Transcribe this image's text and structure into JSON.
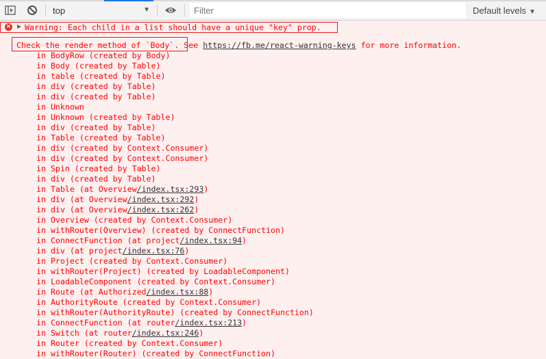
{
  "toolbar": {
    "sidebar_toggle_icon": "sidebar-toggle-icon",
    "clear_icon": "clear-console-icon",
    "context": "top",
    "eye_icon": "live-expression-eye-icon",
    "filter_placeholder": "Filter",
    "filter_value": "",
    "levels_label": "Default levels"
  },
  "message": {
    "level": "error",
    "warning_text": "Warning: Each child in a list should have a unique \"key\" prop.",
    "check_text": "Check the render method of `Body`.",
    "see_text": " See ",
    "link_text": "https://fb.me/react-warning-keys",
    "more_text": " for more information.",
    "stack": [
      {
        "text": "in BodyRow (created by Body)"
      },
      {
        "text": "in Body (created by Table)"
      },
      {
        "text": "in table (created by Table)"
      },
      {
        "text": "in div (created by Table)"
      },
      {
        "text": "in div (created by Table)"
      },
      {
        "text": "in Unknown"
      },
      {
        "text": "in Unknown (created by Table)"
      },
      {
        "text": "in div (created by Table)"
      },
      {
        "text": "in Table (created by Table)"
      },
      {
        "text": "in div (created by Context.Consumer)"
      },
      {
        "text": "in div (created by Context.Consumer)"
      },
      {
        "text": "in Spin (created by Table)"
      },
      {
        "text": "in div (created by Table)"
      },
      {
        "text": "in Table (at Overview",
        "link": "/index.tsx:293",
        "after": ")"
      },
      {
        "text": "in div (at Overview",
        "link": "/index.tsx:292",
        "after": ")"
      },
      {
        "text": "in div (at Overview",
        "link": "/index.tsx:262",
        "after": ")"
      },
      {
        "text": "in Overview (created by Context.Consumer)"
      },
      {
        "text": "in withRouter(Overview) (created by ConnectFunction)"
      },
      {
        "text": "in ConnectFunction (at project",
        "link": "/index.tsx:94",
        "after": ")"
      },
      {
        "text": "in div (at project",
        "link": "/index.tsx:76",
        "after": ")"
      },
      {
        "text": "in Project (created by Context.Consumer)"
      },
      {
        "text": "in withRouter(Project) (created by LoadableComponent)"
      },
      {
        "text": "in LoadableComponent (created by Context.Consumer)"
      },
      {
        "text": "in Route (at Authorized",
        "link": "/index.tsx:88",
        "after": ")"
      },
      {
        "text": "in AuthorityRoute (created by Context.Consumer)"
      },
      {
        "text": "in withRouter(AuthorityRoute) (created by ConnectFunction)"
      },
      {
        "text": "in ConnectFunction (at router",
        "link": "/index.tsx:213",
        "after": ")"
      },
      {
        "text": "in Switch (at router",
        "link": "/index.tsx:246",
        "after": ")"
      },
      {
        "text": "in Router (created by Context.Consumer)"
      },
      {
        "text": "in withRouter(Router) (created by ConnectFunction)"
      }
    ]
  }
}
